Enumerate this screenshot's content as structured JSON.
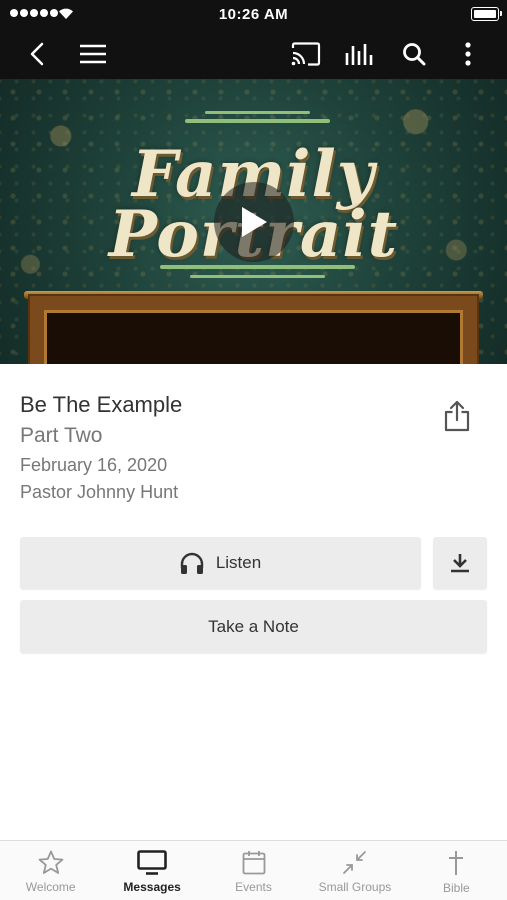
{
  "status_bar": {
    "time": "10:26 AM"
  },
  "nav": {
    "icons": [
      "back-icon",
      "menu-icon",
      "cast-icon",
      "equalizer-icon",
      "search-icon",
      "more-icon"
    ]
  },
  "hero": {
    "title_line1": "Family",
    "title_line2": "Portrait"
  },
  "message": {
    "title": "Be The Example",
    "subtitle": "Part Two",
    "date": "February 16, 2020",
    "speaker": "Pastor Johnny Hunt"
  },
  "actions": {
    "listen_label": "Listen",
    "take_note_label": "Take a Note"
  },
  "tab_bar": {
    "active": "Messages",
    "tabs": [
      {
        "label": "Welcome",
        "icon": "star-icon"
      },
      {
        "label": "Messages",
        "icon": "tv-icon"
      },
      {
        "label": "Events",
        "icon": "calendar-icon"
      },
      {
        "label": "Small Groups",
        "icon": "compress-icon"
      },
      {
        "label": "Bible",
        "icon": "cross-icon"
      }
    ]
  },
  "colors": {
    "nav_bg": "#111111",
    "button_bg": "#ececec",
    "tab_active": "#222222",
    "tab_inactive": "#999999"
  }
}
